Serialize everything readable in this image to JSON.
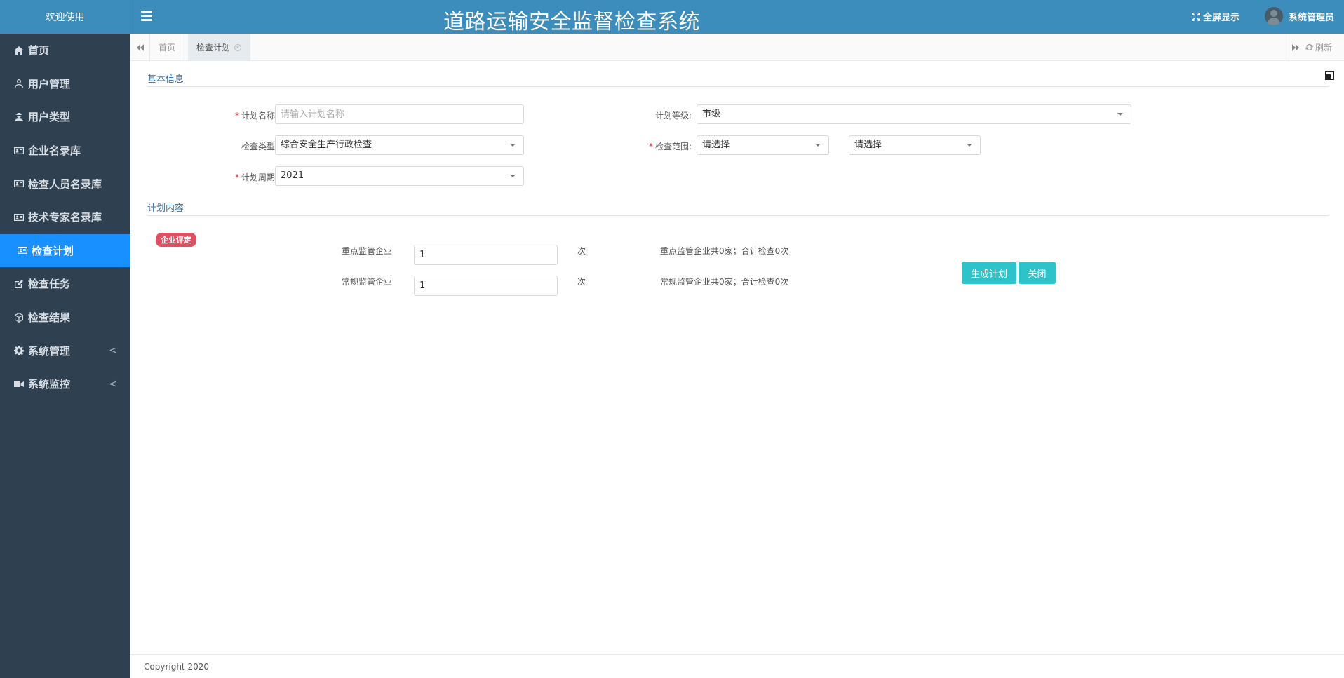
{
  "sidebar": {
    "brand": "欢迎使用",
    "items": [
      {
        "label": "首页",
        "icon": "home-icon"
      },
      {
        "label": "用户管理",
        "icon": "user-icon"
      },
      {
        "label": "用户类型",
        "icon": "user-secret-icon"
      },
      {
        "label": "企业名录库",
        "icon": "id-card-icon"
      },
      {
        "label": "检查人员名录库",
        "icon": "id-card-icon"
      },
      {
        "label": "技术专家名录库",
        "icon": "id-card-icon"
      },
      {
        "label": "检查计划",
        "icon": "id-card-icon",
        "active": true
      },
      {
        "label": "检查任务",
        "icon": "edit-icon"
      },
      {
        "label": "检查结果",
        "icon": "cube-icon"
      },
      {
        "label": "系统管理",
        "icon": "gear-icon",
        "chevron": "<"
      },
      {
        "label": "系统监控",
        "icon": "video-icon",
        "chevron": "<"
      }
    ]
  },
  "header": {
    "title": "道路运输安全监督检查系统",
    "fullscreen": "全屏显示",
    "user": "系统管理员"
  },
  "tabs": {
    "home": "首页",
    "current": "检查计划",
    "refresh": "刷新"
  },
  "form": {
    "section_basic": "基本信息",
    "plan_name_label": "计划名称:",
    "plan_name_placeholder": "请输入计划名称",
    "plan_name_value": "",
    "plan_level_label": "计划等级:",
    "plan_level_value": "市级",
    "check_type_label": "检查类型:",
    "check_type_value": "综合安全生产行政检查",
    "check_scope_label": "检查范围:",
    "check_scope_value_1": "请选择",
    "check_scope_value_2": "请选择",
    "plan_period_label": "计划周期:",
    "plan_period_value": "2021"
  },
  "content": {
    "section_title": "计划内容",
    "badge": "企业评定",
    "key_label": "重点监管企业",
    "key_value": "1",
    "key_unit": "次",
    "key_summary": "重点监管企业共0家；合计检查0次",
    "normal_label": "常规监管企业",
    "normal_value": "1",
    "normal_unit": "次",
    "normal_summary": "常规监管企业共0家；合计检查0次",
    "generate_button": "生成计划",
    "close_button": "关闭"
  },
  "footer": {
    "copyright": "Copyright 2020"
  },
  "colors": {
    "header_blue": "#3c8dbc",
    "sidebar_dark": "#2f4050",
    "active_blue": "#1890ff",
    "button_teal": "#2dc3c8",
    "badge_red": "#e05060"
  }
}
